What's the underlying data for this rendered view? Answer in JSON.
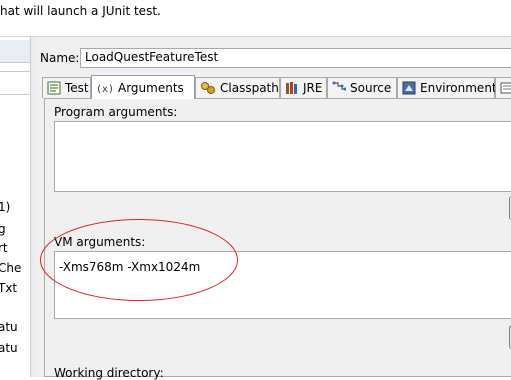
{
  "header": {
    "description": "hat will launch a JUnit test."
  },
  "left_panel": {
    "items": [
      "1)",
      "g",
      "rt",
      "Che",
      "Txt",
      "atu",
      "atu"
    ]
  },
  "config": {
    "name_label": "Name:",
    "name_value": "LoadQuestFeatureTest"
  },
  "tabs": [
    {
      "label": "Test",
      "icon": "junit-test-icon"
    },
    {
      "label": "Arguments",
      "icon": "arguments-icon",
      "active": true
    },
    {
      "label": "Classpath",
      "icon": "classpath-icon"
    },
    {
      "label": "JRE",
      "icon": "jre-icon"
    },
    {
      "label": "Source",
      "icon": "source-icon"
    },
    {
      "label": "Environment",
      "icon": "environment-icon"
    },
    {
      "label": "",
      "icon": "common-icon"
    }
  ],
  "arguments": {
    "program_label": "Program arguments:",
    "program_value": "",
    "vm_label": "VM arguments:",
    "vm_value": "-Xms768m -Xmx1024m",
    "working_dir_label": "Working directory:"
  },
  "annotation": {
    "shape": "ellipse",
    "color": "#e0202a"
  }
}
